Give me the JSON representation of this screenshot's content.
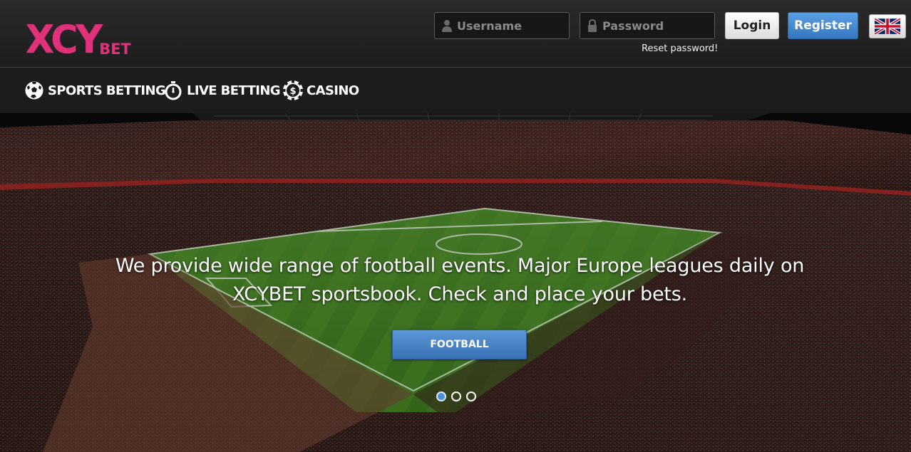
{
  "brand": {
    "logo_main": "XCY",
    "logo_sub": "BET",
    "color": "#e0317a"
  },
  "login": {
    "username_placeholder": "Username",
    "password_placeholder": "Password",
    "reset_password": "Reset password!",
    "login_label": "Login",
    "register_label": "Register",
    "language_icon": "uk-flag-icon"
  },
  "nav": {
    "items": [
      {
        "label": "SPORTS BETTING",
        "icon": "soccer-ball-icon"
      },
      {
        "label": "LIVE BETTING",
        "icon": "stopwatch-icon"
      },
      {
        "label": "CASINO",
        "icon": "casino-chip-icon"
      }
    ]
  },
  "hero": {
    "text": "We provide wide range of football events. Major Europe leagues daily on XCYBET sportsbook. Check and place your bets.",
    "button_label": "FOOTBALL",
    "slides_total": 3,
    "active_slide": 1
  },
  "colors": {
    "accent_blue": "#3a7bc8",
    "header_bg": "#222222"
  }
}
